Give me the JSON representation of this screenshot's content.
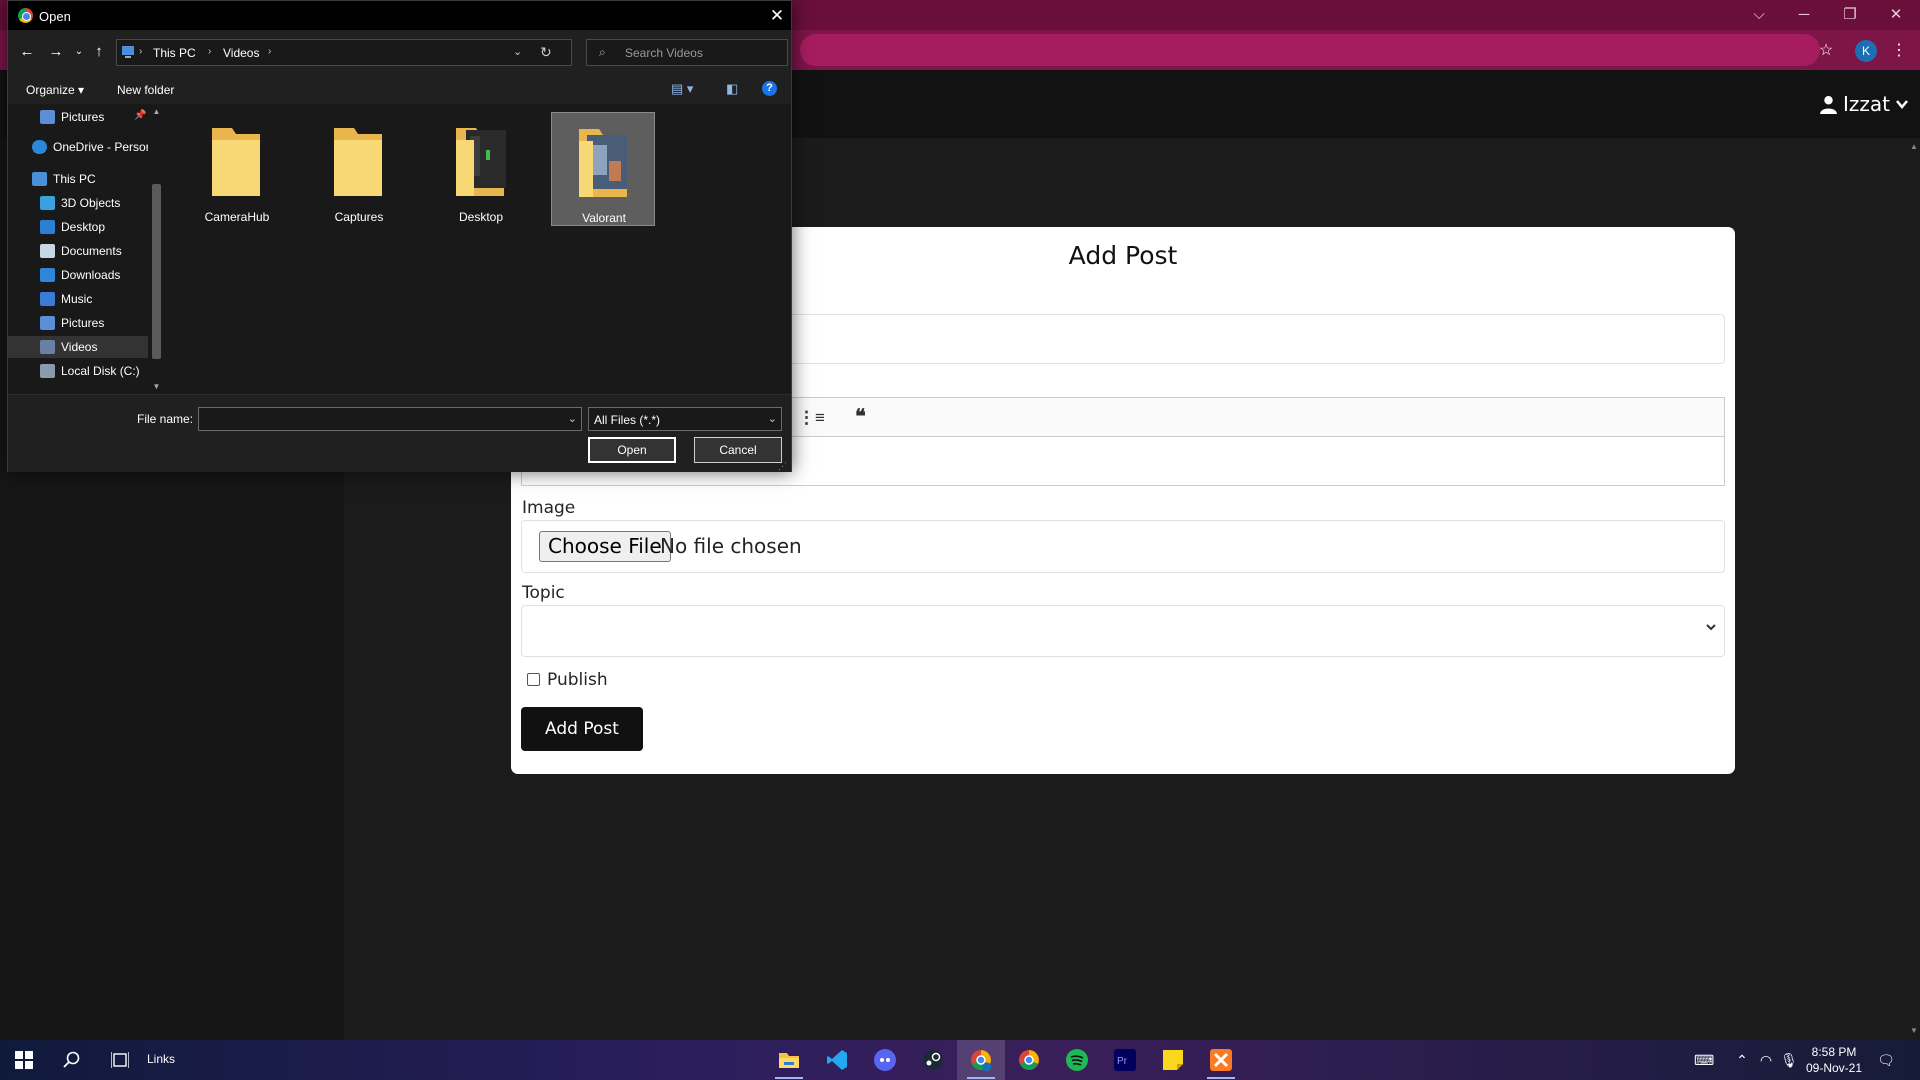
{
  "browser": {
    "window_controls": {
      "minimize": "─",
      "maximize": "❐",
      "close": "✕"
    },
    "tab_search_glyph": "⌵",
    "profile_initial": "K",
    "bookmark_icon": "star-icon",
    "menu_icon": "kebab-menu-icon"
  },
  "site": {
    "user_name": "Izzat"
  },
  "form": {
    "title": "Add Post",
    "image_label": "Image",
    "choose_file": "Choose File",
    "no_file": "No file chosen",
    "topic_label": "Topic",
    "publish_label": "Publish",
    "submit_label": "Add Post",
    "editor_tools": [
      "numbered-list-icon",
      "quote-icon"
    ]
  },
  "dialog": {
    "title": "Open",
    "breadcrumb": [
      "This PC",
      "Videos"
    ],
    "search_placeholder": "Search Videos",
    "organize": "Organize",
    "new_folder": "New folder",
    "nav_items": [
      {
        "label": "Pictures",
        "icon": "pictures-icon",
        "pinned": true
      },
      {
        "label": "OneDrive - Persor",
        "icon": "onedrive-icon"
      },
      {
        "label": "This PC",
        "icon": "this-pc-icon"
      },
      {
        "label": "3D Objects",
        "icon": "3d-objects-icon"
      },
      {
        "label": "Desktop",
        "icon": "desktop-icon"
      },
      {
        "label": "Documents",
        "icon": "documents-icon"
      },
      {
        "label": "Downloads",
        "icon": "downloads-icon"
      },
      {
        "label": "Music",
        "icon": "music-icon"
      },
      {
        "label": "Pictures",
        "icon": "pictures-icon"
      },
      {
        "label": "Videos",
        "icon": "videos-icon",
        "selected": true
      },
      {
        "label": "Local Disk (C:)",
        "icon": "local-disk-icon"
      }
    ],
    "folders": [
      {
        "name": "CameraHub",
        "selected": false
      },
      {
        "name": "Captures",
        "selected": false
      },
      {
        "name": "Desktop",
        "selected": false
      },
      {
        "name": "Valorant",
        "selected": true
      }
    ],
    "file_name_label": "File name:",
    "file_name_value": "",
    "file_type": "All Files (*.*)",
    "open_button": "Open",
    "cancel_button": "Cancel"
  },
  "taskbar": {
    "links_label": "Links",
    "apps": [
      "file-explorer-icon",
      "vscode-icon",
      "discord-icon",
      "steam-icon",
      "chrome-profile-icon",
      "chrome-icon",
      "spotify-icon",
      "premiere-pro-icon",
      "sticky-notes-icon",
      "xampp-icon"
    ],
    "time": "8:58 PM",
    "date": "09-Nov-21"
  },
  "colors": {
    "browser_frame": "#6a0f3a",
    "browser_toolbar": "#7d1546",
    "page_bg": "#1b1b1b",
    "card_bg": "#ffffff",
    "submit_bg": "#111111",
    "dialog_bg": "#202020",
    "dialog_selected": "#5e5e5e",
    "accent_blue": "#1a73e8"
  }
}
